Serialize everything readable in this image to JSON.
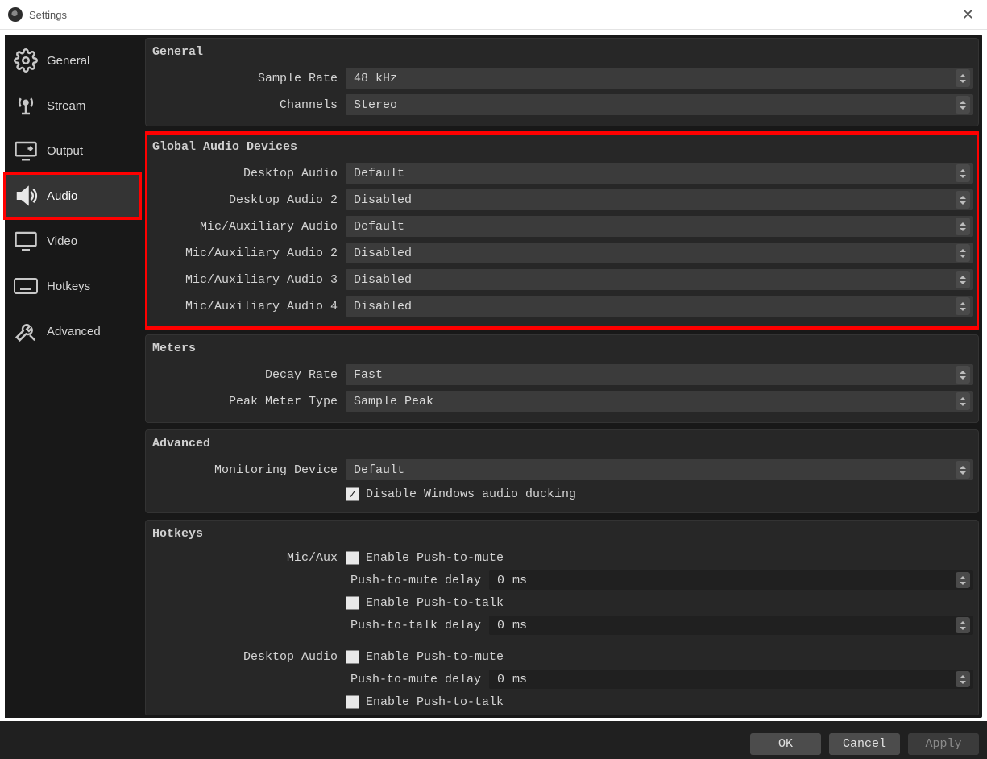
{
  "window": {
    "title": "Settings"
  },
  "sidebar": {
    "items": [
      {
        "label": "General"
      },
      {
        "label": "Stream"
      },
      {
        "label": "Output"
      },
      {
        "label": "Audio"
      },
      {
        "label": "Video"
      },
      {
        "label": "Hotkeys"
      },
      {
        "label": "Advanced"
      }
    ]
  },
  "groups": {
    "general": {
      "title": "General",
      "sample_rate_label": "Sample Rate",
      "sample_rate_value": "48 kHz",
      "channels_label": "Channels",
      "channels_value": "Stereo"
    },
    "global": {
      "title": "Global Audio Devices",
      "rows": [
        {
          "label": "Desktop Audio",
          "value": "Default"
        },
        {
          "label": "Desktop Audio 2",
          "value": "Disabled"
        },
        {
          "label": "Mic/Auxiliary Audio",
          "value": "Default"
        },
        {
          "label": "Mic/Auxiliary Audio 2",
          "value": "Disabled"
        },
        {
          "label": "Mic/Auxiliary Audio 3",
          "value": "Disabled"
        },
        {
          "label": "Mic/Auxiliary Audio 4",
          "value": "Disabled"
        }
      ]
    },
    "meters": {
      "title": "Meters",
      "decay_label": "Decay Rate",
      "decay_value": "Fast",
      "peak_label": "Peak Meter Type",
      "peak_value": "Sample Peak"
    },
    "advanced": {
      "title": "Advanced",
      "mon_label": "Monitoring Device",
      "mon_value": "Default",
      "ducking_label": "Disable Windows audio ducking"
    },
    "hotkeys": {
      "title": "Hotkeys",
      "micaux_label": "Mic/Aux",
      "desktop_label": "Desktop Audio",
      "push_mute": "Enable Push-to-mute",
      "push_mute_delay": "Push-to-mute delay",
      "push_talk": "Enable Push-to-talk",
      "push_talk_delay": "Push-to-talk delay",
      "delay_val": "0",
      "delay_unit": "ms"
    }
  },
  "buttons": {
    "ok": "OK",
    "cancel": "Cancel",
    "apply": "Apply"
  }
}
